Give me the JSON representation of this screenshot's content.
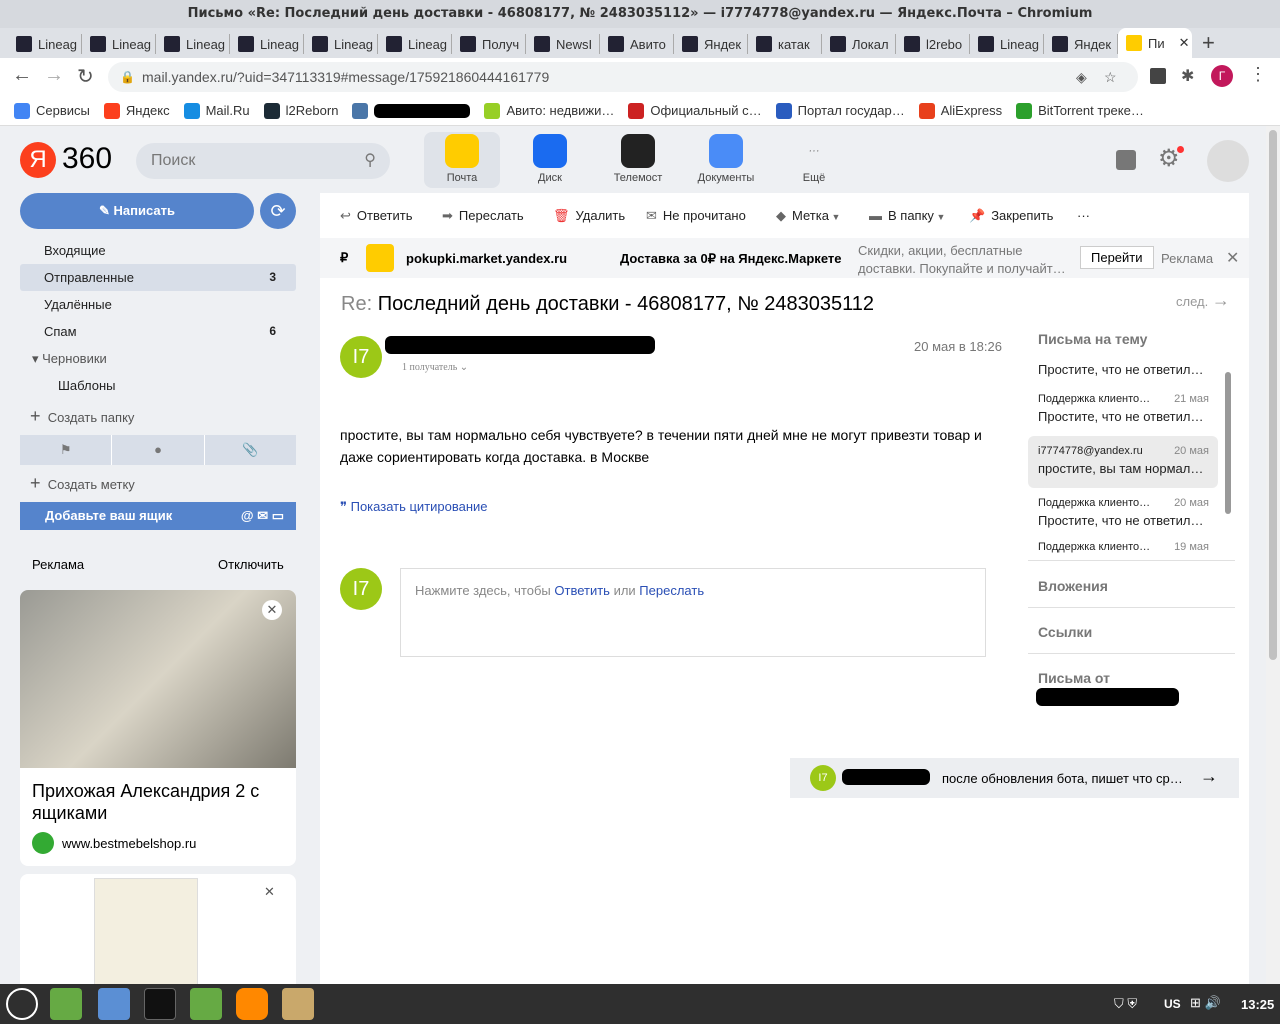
{
  "window": {
    "title": "Письмо «Re: Последний день доставки -  46808177, № 2483035112» — i7774778@yandex.ru — Яндекс.Почта – Chromium"
  },
  "tabs": [
    {
      "label": "Lineag",
      "icon": "lineage-icon"
    },
    {
      "label": "Lineag",
      "icon": "lineage-icon"
    },
    {
      "label": "Lineag",
      "icon": "lineage-icon"
    },
    {
      "label": "Lineag",
      "icon": "lineage-icon"
    },
    {
      "label": "Lineag",
      "icon": "lineage-icon"
    },
    {
      "label": "Lineag",
      "icon": "lineage-icon"
    },
    {
      "label": "Получ",
      "icon": "speech-icon"
    },
    {
      "label": "NewsI",
      "icon": "news-icon"
    },
    {
      "label": "Авито",
      "icon": "avito-icon"
    },
    {
      "label": "Яндек",
      "icon": "yandex-market-icon"
    },
    {
      "label": "катак",
      "icon": "yandex-icon"
    },
    {
      "label": "Локал",
      "icon": "li-icon"
    },
    {
      "label": "l2rebo",
      "icon": "l2-icon"
    },
    {
      "label": "Lineag",
      "icon": "lineage-icon"
    },
    {
      "label": "Яндек",
      "icon": "yandex-icon"
    },
    {
      "label": "Пи",
      "icon": "mail-icon",
      "active": true
    }
  ],
  "address": {
    "url": "mail.yandex.ru/?uid=347113319#message/175921860444161779",
    "profile_initial": "Г"
  },
  "bookmarks": [
    {
      "label": "Сервисы",
      "color": "#4285f4"
    },
    {
      "label": "Яндекс",
      "color": "#fc3f1d"
    },
    {
      "label": "Mail.Ru",
      "color": "#168de2"
    },
    {
      "label": "l2Reborn",
      "color": "#1c2b36"
    },
    {
      "label": "",
      "color": "#4a76a8"
    },
    {
      "label": "Авито: недвижи…",
      "color": "#97cf26"
    },
    {
      "label": "Официальный с…",
      "color": "#cc2222"
    },
    {
      "label": "Портал государ…",
      "color": "#2a5cbf"
    },
    {
      "label": "AliExpress",
      "color": "#e8401c"
    },
    {
      "label": "BitTorrent треке…",
      "color": "#2ca02c"
    }
  ],
  "header": {
    "logo": "360",
    "search_placeholder": "Поиск",
    "services": [
      {
        "label": "Почта",
        "color": "#ffcc00"
      },
      {
        "label": "Диск",
        "color": "#1a6bf0"
      },
      {
        "label": "Телемост",
        "color": "#222"
      },
      {
        "label": "Документы",
        "color": "#4a8cf7"
      },
      {
        "label": "Ещё",
        "color": "transparent"
      }
    ]
  },
  "sidebar": {
    "compose": "Написать",
    "folders": [
      {
        "label": "Входящие",
        "count": ""
      },
      {
        "label": "Отправленные",
        "count": "3",
        "selected": true
      },
      {
        "label": "Удалённые",
        "count": ""
      },
      {
        "label": "Спам",
        "count": "6"
      },
      {
        "label": "▾ Черновики",
        "count": ""
      },
      {
        "label": "Шаблоны",
        "count": ""
      }
    ],
    "create_folder": "Создать папку",
    "create_label": "Создать метку",
    "add_mailbox": "Добавьте ваш ящик",
    "ads_label": "Реклама",
    "ads_disable": "Отключить",
    "ad1": {
      "title": "Прихожая Александрия 2 с ящиками",
      "domain": "www.bestmebelshop.ru"
    }
  },
  "toolbar": {
    "reply": "Ответить",
    "forward": "Переслать",
    "delete": "Удалить",
    "unread": "Не прочитано",
    "label": "Метка",
    "folder": "В папку",
    "pin": "Закрепить",
    "more": "···"
  },
  "banner": {
    "currency": "₽",
    "domain": "pokupki.market.yandex.ru",
    "headline": "Доставка за 0₽ на Яндекс.Маркете",
    "text": "Скидки, акции, бесплатные доставки. Покупайте и получайт…",
    "button": "Перейти",
    "ad": "Реклама"
  },
  "message": {
    "prefix": "Re:",
    "subject": "Последний день доставки -  46808177, № 2483035112",
    "next": "след.",
    "avatar": "I7",
    "recipients": "1 получатель",
    "date": "20 мая в 18:26",
    "body": "простите, вы там нормально себя чувствуете? в течении пяти дней мне не могут привезти товар и даже сориентировать когда доставка. в Москве",
    "show_quote": "Показать цитирование",
    "reply_hint_pre": "Нажмите здесь, чтобы ",
    "reply_link": "Ответить",
    "reply_or": " или ",
    "forward_link": "Переслать"
  },
  "thread": {
    "title": "Письма на тему",
    "items": [
      {
        "from": "",
        "date": "",
        "snippet": "Простите, что не ответил…"
      },
      {
        "from": "Поддержка клиенто…",
        "date": "21 мая",
        "snippet": "Простите, что не ответил…"
      },
      {
        "from": "i7774778@yandex.ru",
        "date": "20 мая",
        "snippet": "простите, вы там нормал…",
        "selected": true
      },
      {
        "from": "Поддержка клиенто…",
        "date": "20 мая",
        "snippet": "Простите, что не ответил…"
      },
      {
        "from": "Поддержка клиенто…",
        "date": "19 мая",
        "snippet": ""
      }
    ],
    "attachments": "Вложения",
    "links": "Ссылки",
    "from_title": "Письма от"
  },
  "next_msg": {
    "avatar": "I7",
    "snippet": "после обновления бота, пишет что ср…"
  },
  "taskbar": {
    "lang": "US",
    "time": "13:25"
  }
}
